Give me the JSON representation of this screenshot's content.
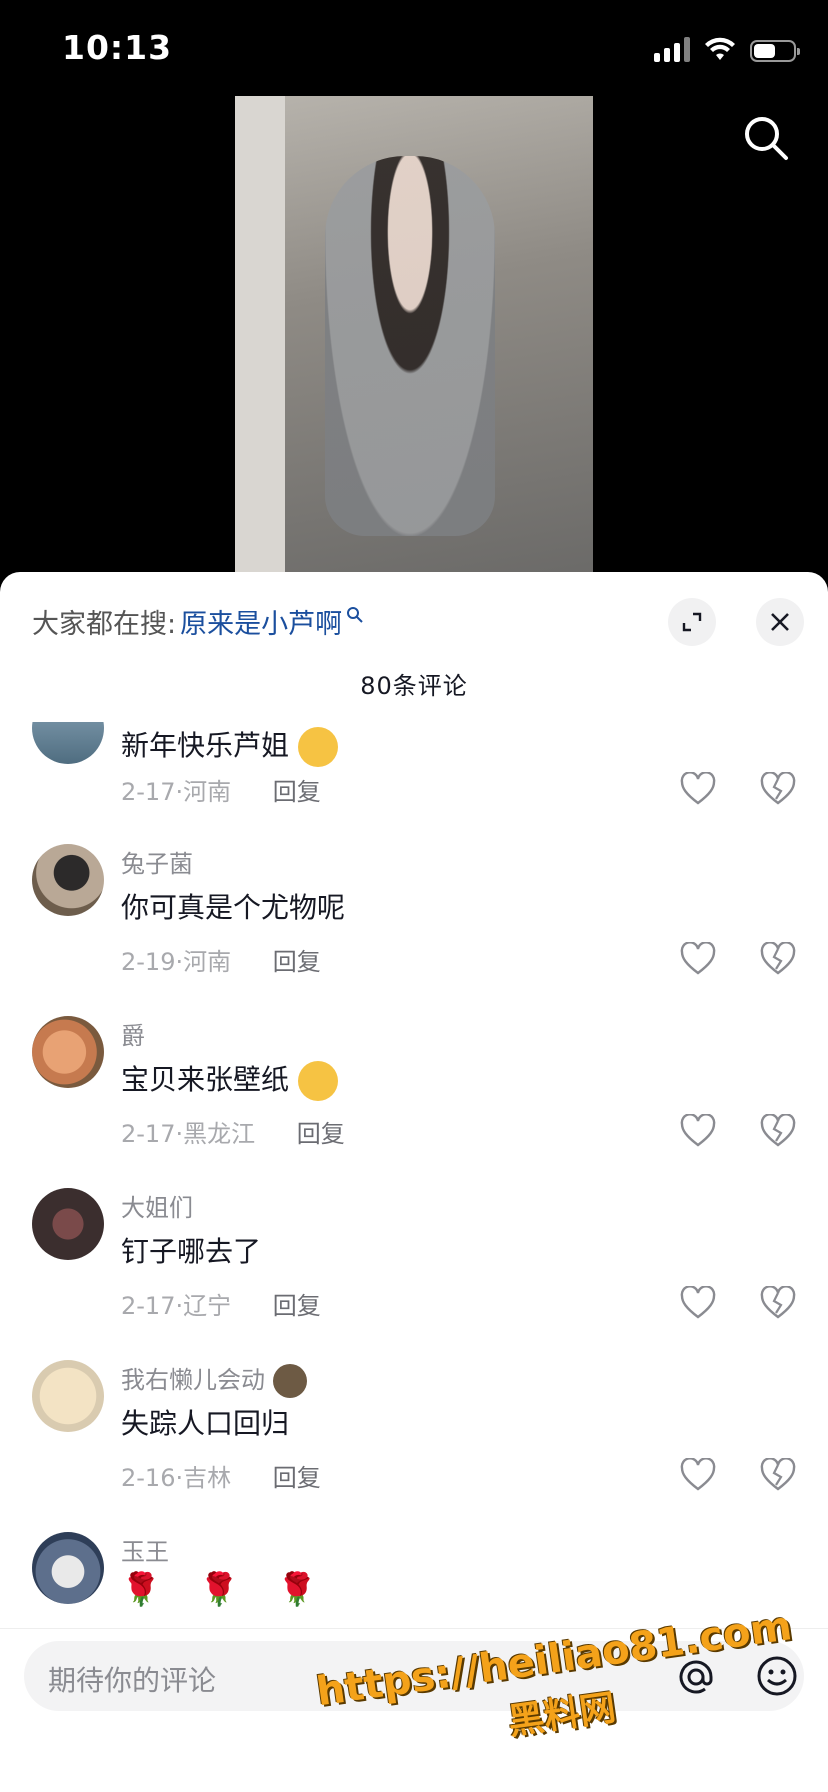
{
  "status": {
    "time": "10:13",
    "battery_level": 0.55
  },
  "sheet": {
    "suggest_label": "大家都在搜:",
    "suggest_link": "原来是小芦啊",
    "comment_count": "80条评论"
  },
  "comments": [
    {
      "username": "",
      "text": "新年快乐芦姐",
      "date": "2-17",
      "location": "河南",
      "reply": "回复"
    },
    {
      "username": "兔子菌",
      "text": "你可真是个尤物呢",
      "date": "2-19",
      "location": "河南",
      "reply": "回复"
    },
    {
      "username": "爵",
      "text": "宝贝来张壁纸",
      "date": "2-17",
      "location": "黑龙江",
      "reply": "回复"
    },
    {
      "username": "大姐们",
      "text": "钉子哪去了",
      "date": "2-17",
      "location": "辽宁",
      "reply": "回复"
    },
    {
      "username": "我右懒儿会动",
      "text": "失踪人口回归",
      "date": "2-16",
      "location": "吉林",
      "reply": "回复"
    },
    {
      "username": "玉王",
      "text": "🌹 🌹 🌹"
    }
  ],
  "input": {
    "placeholder": "期待你的评论"
  },
  "watermark": {
    "url": "https://heiliao81.com",
    "name": "黑料网"
  },
  "colors": {
    "link": "#1b4f9e",
    "watermark": "#f4a21a"
  }
}
